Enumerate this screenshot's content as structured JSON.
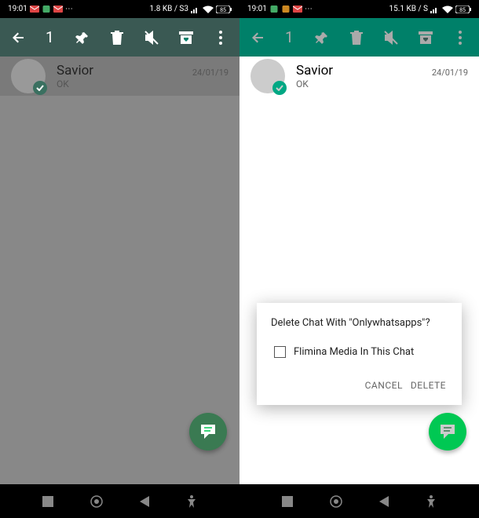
{
  "status": {
    "time": "19:01",
    "data_rate_left": "1.8 KB / S3",
    "data_rate_right": "15.1 KB / S",
    "battery": "85"
  },
  "toolbar": {
    "selection_count": "1"
  },
  "chat": {
    "name": "Savior",
    "preview": "OK",
    "date": "24/01/19"
  },
  "dialog": {
    "title": "Delete Chat With \"Onlywhatsapps\"?",
    "checkbox_label": "Flimina Media In This Chat",
    "cancel": "CANCEL",
    "delete": "DELETE"
  }
}
